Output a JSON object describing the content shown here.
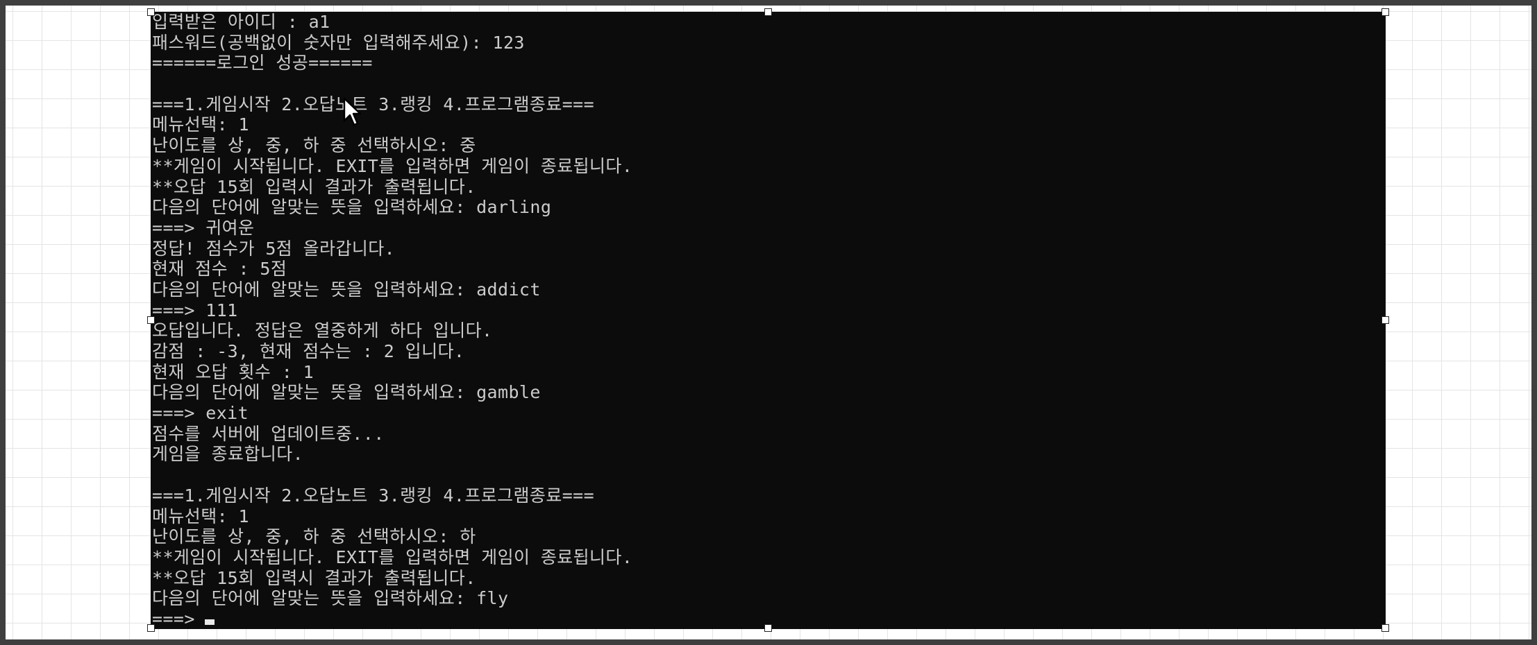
{
  "canvas": {
    "background": "#ffffff",
    "grid_color": "#e4e4e4",
    "frame_color": "#3f3f3f"
  },
  "console": {
    "background": "#0c0c0c",
    "text_color": "#cccccc",
    "lines": [
      "입력받은 아이디 : a1",
      "패스워드(공백없이 숫자만 입력해주세요): 123",
      "======로그인 성공======",
      "",
      "===1.게임시작 2.오답노트 3.랭킹 4.프로그램종료===",
      "메뉴선택: 1",
      "난이도를 상, 중, 하 중 선택하시오: 중",
      "**게임이 시작됩니다. EXIT를 입력하면 게임이 종료됩니다.",
      "**오답 15회 입력시 결과가 출력됩니다.",
      "다음의 단어에 알맞는 뜻을 입력하세요: darling",
      "===> 귀여운",
      "정답! 점수가 5점 올라갑니다.",
      "현재 점수 : 5점",
      "다음의 단어에 알맞는 뜻을 입력하세요: addict",
      "===> 111",
      "오답입니다. 정답은 열중하게 하다 입니다.",
      "감점 : -3, 현재 점수는 : 2 입니다.",
      "현재 오답 횟수 : 1",
      "다음의 단어에 알맞는 뜻을 입력하세요: gamble",
      "===> exit",
      "점수를 서버에 업데이트중...",
      "게임을 종료합니다.",
      "",
      "===1.게임시작 2.오답노트 3.랭킹 4.프로그램종료===",
      "메뉴선택: 1",
      "난이도를 상, 중, 하 중 선택하시오: 하",
      "**게임이 시작됩니다. EXIT를 입력하면 게임이 종료됩니다.",
      "**오답 15회 입력시 결과가 출력됩니다.",
      "다음의 단어에 알맞는 뜻을 입력하세요: fly"
    ],
    "prompt": "===>"
  },
  "icons": {
    "pointer": "mouse-pointer-icon",
    "cursor": "text-cursor-icon"
  }
}
